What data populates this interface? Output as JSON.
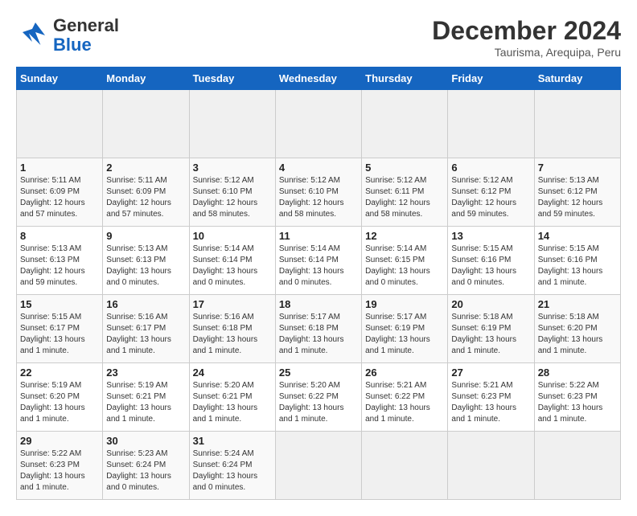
{
  "header": {
    "logo_general": "General",
    "logo_blue": "Blue",
    "title": "December 2024",
    "subtitle": "Taurisma, Arequipa, Peru"
  },
  "calendar": {
    "days_of_week": [
      "Sunday",
      "Monday",
      "Tuesday",
      "Wednesday",
      "Thursday",
      "Friday",
      "Saturday"
    ],
    "weeks": [
      [
        {
          "day": "",
          "empty": true
        },
        {
          "day": "",
          "empty": true
        },
        {
          "day": "",
          "empty": true
        },
        {
          "day": "",
          "empty": true
        },
        {
          "day": "",
          "empty": true
        },
        {
          "day": "",
          "empty": true
        },
        {
          "day": "",
          "empty": true
        }
      ],
      [
        {
          "day": "1",
          "detail": "Sunrise: 5:11 AM\nSunset: 6:09 PM\nDaylight: 12 hours\nand 57 minutes."
        },
        {
          "day": "2",
          "detail": "Sunrise: 5:11 AM\nSunset: 6:09 PM\nDaylight: 12 hours\nand 57 minutes."
        },
        {
          "day": "3",
          "detail": "Sunrise: 5:12 AM\nSunset: 6:10 PM\nDaylight: 12 hours\nand 58 minutes."
        },
        {
          "day": "4",
          "detail": "Sunrise: 5:12 AM\nSunset: 6:10 PM\nDaylight: 12 hours\nand 58 minutes."
        },
        {
          "day": "5",
          "detail": "Sunrise: 5:12 AM\nSunset: 6:11 PM\nDaylight: 12 hours\nand 58 minutes."
        },
        {
          "day": "6",
          "detail": "Sunrise: 5:12 AM\nSunset: 6:12 PM\nDaylight: 12 hours\nand 59 minutes."
        },
        {
          "day": "7",
          "detail": "Sunrise: 5:13 AM\nSunset: 6:12 PM\nDaylight: 12 hours\nand 59 minutes."
        }
      ],
      [
        {
          "day": "8",
          "detail": "Sunrise: 5:13 AM\nSunset: 6:13 PM\nDaylight: 12 hours\nand 59 minutes."
        },
        {
          "day": "9",
          "detail": "Sunrise: 5:13 AM\nSunset: 6:13 PM\nDaylight: 13 hours\nand 0 minutes."
        },
        {
          "day": "10",
          "detail": "Sunrise: 5:14 AM\nSunset: 6:14 PM\nDaylight: 13 hours\nand 0 minutes."
        },
        {
          "day": "11",
          "detail": "Sunrise: 5:14 AM\nSunset: 6:14 PM\nDaylight: 13 hours\nand 0 minutes."
        },
        {
          "day": "12",
          "detail": "Sunrise: 5:14 AM\nSunset: 6:15 PM\nDaylight: 13 hours\nand 0 minutes."
        },
        {
          "day": "13",
          "detail": "Sunrise: 5:15 AM\nSunset: 6:16 PM\nDaylight: 13 hours\nand 0 minutes."
        },
        {
          "day": "14",
          "detail": "Sunrise: 5:15 AM\nSunset: 6:16 PM\nDaylight: 13 hours\nand 1 minute."
        }
      ],
      [
        {
          "day": "15",
          "detail": "Sunrise: 5:15 AM\nSunset: 6:17 PM\nDaylight: 13 hours\nand 1 minute."
        },
        {
          "day": "16",
          "detail": "Sunrise: 5:16 AM\nSunset: 6:17 PM\nDaylight: 13 hours\nand 1 minute."
        },
        {
          "day": "17",
          "detail": "Sunrise: 5:16 AM\nSunset: 6:18 PM\nDaylight: 13 hours\nand 1 minute."
        },
        {
          "day": "18",
          "detail": "Sunrise: 5:17 AM\nSunset: 6:18 PM\nDaylight: 13 hours\nand 1 minute."
        },
        {
          "day": "19",
          "detail": "Sunrise: 5:17 AM\nSunset: 6:19 PM\nDaylight: 13 hours\nand 1 minute."
        },
        {
          "day": "20",
          "detail": "Sunrise: 5:18 AM\nSunset: 6:19 PM\nDaylight: 13 hours\nand 1 minute."
        },
        {
          "day": "21",
          "detail": "Sunrise: 5:18 AM\nSunset: 6:20 PM\nDaylight: 13 hours\nand 1 minute."
        }
      ],
      [
        {
          "day": "22",
          "detail": "Sunrise: 5:19 AM\nSunset: 6:20 PM\nDaylight: 13 hours\nand 1 minute."
        },
        {
          "day": "23",
          "detail": "Sunrise: 5:19 AM\nSunset: 6:21 PM\nDaylight: 13 hours\nand 1 minute."
        },
        {
          "day": "24",
          "detail": "Sunrise: 5:20 AM\nSunset: 6:21 PM\nDaylight: 13 hours\nand 1 minute."
        },
        {
          "day": "25",
          "detail": "Sunrise: 5:20 AM\nSunset: 6:22 PM\nDaylight: 13 hours\nand 1 minute."
        },
        {
          "day": "26",
          "detail": "Sunrise: 5:21 AM\nSunset: 6:22 PM\nDaylight: 13 hours\nand 1 minute."
        },
        {
          "day": "27",
          "detail": "Sunrise: 5:21 AM\nSunset: 6:23 PM\nDaylight: 13 hours\nand 1 minute."
        },
        {
          "day": "28",
          "detail": "Sunrise: 5:22 AM\nSunset: 6:23 PM\nDaylight: 13 hours\nand 1 minute."
        }
      ],
      [
        {
          "day": "29",
          "detail": "Sunrise: 5:22 AM\nSunset: 6:23 PM\nDaylight: 13 hours\nand 1 minute."
        },
        {
          "day": "30",
          "detail": "Sunrise: 5:23 AM\nSunset: 6:24 PM\nDaylight: 13 hours\nand 0 minutes."
        },
        {
          "day": "31",
          "detail": "Sunrise: 5:24 AM\nSunset: 6:24 PM\nDaylight: 13 hours\nand 0 minutes."
        },
        {
          "day": "",
          "empty": true
        },
        {
          "day": "",
          "empty": true
        },
        {
          "day": "",
          "empty": true
        },
        {
          "day": "",
          "empty": true
        }
      ]
    ]
  }
}
